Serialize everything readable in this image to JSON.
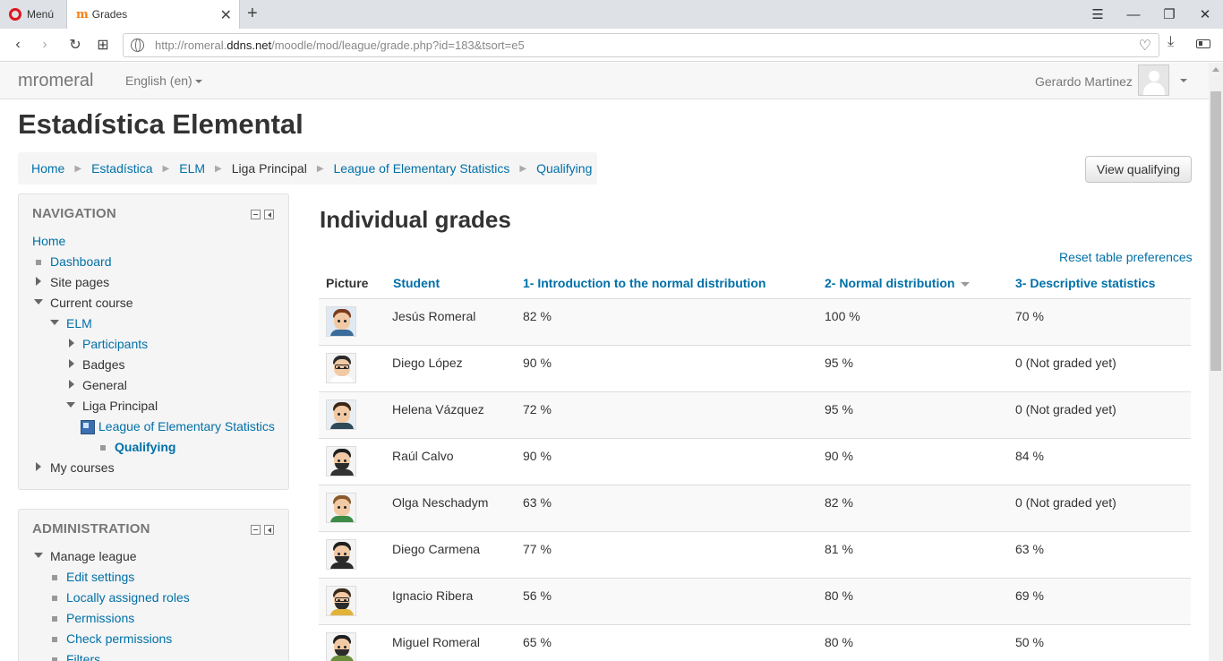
{
  "browser": {
    "menu_label": "Menú",
    "tab_title": "Grades",
    "url_prefix": "http://romeral.",
    "url_domain": "ddns.net",
    "url_path": "/moodle/mod/league/grade.php?id=183&tsort=e5"
  },
  "navbar": {
    "brand": "mromeral",
    "language": "English (en)",
    "user": "Gerardo Martinez"
  },
  "page": {
    "course_title": "Estadística Elemental",
    "breadcrumb": [
      "Home",
      "Estadística",
      "ELM",
      "Liga Principal",
      "League of Elementary Statistics",
      "Qualifying"
    ],
    "view_button": "View qualifying"
  },
  "navigation": {
    "title": "NAVIGATION",
    "home": "Home",
    "dashboard": "Dashboard",
    "site_pages": "Site pages",
    "current_course": "Current course",
    "course_short": "ELM",
    "participants": "Participants",
    "badges": "Badges",
    "general": "General",
    "liga": "Liga Principal",
    "league": "League of Elementary Statistics",
    "qualifying": "Qualifying",
    "my_courses": "My courses"
  },
  "administration": {
    "title": "ADMINISTRATION",
    "manage": "Manage league",
    "items": [
      "Edit settings",
      "Locally assigned roles",
      "Permissions",
      "Check permissions",
      "Filters"
    ]
  },
  "grades": {
    "heading": "Individual grades",
    "reset": "Reset table preferences",
    "columns": [
      "Picture",
      "Student",
      "1- Introduction to the normal distribution",
      "2- Normal distribution",
      "3- Descriptive statistics"
    ],
    "rows": [
      {
        "student": "Jesús Romeral",
        "g1": "82 %",
        "g2": "100 %",
        "g3": "70 %"
      },
      {
        "student": "Diego López",
        "g1": "90 %",
        "g2": "95 %",
        "g3": "0 (Not graded yet)"
      },
      {
        "student": "Helena Vázquez",
        "g1": "72 %",
        "g2": "95 %",
        "g3": "0 (Not graded yet)"
      },
      {
        "student": "Raúl Calvo",
        "g1": "90 %",
        "g2": "90 %",
        "g3": "84 %"
      },
      {
        "student": "Olga Neschadym",
        "g1": "63 %",
        "g2": "82 %",
        "g3": "0 (Not graded yet)"
      },
      {
        "student": "Diego Carmena",
        "g1": "77 %",
        "g2": "81 %",
        "g3": "63 %"
      },
      {
        "student": "Ignacio Ribera",
        "g1": "56 %",
        "g2": "80 %",
        "g3": "69 %"
      },
      {
        "student": "Miguel Romeral",
        "g1": "65 %",
        "g2": "80 %",
        "g3": "50 %"
      }
    ]
  },
  "colors": {
    "link": "#0070a8",
    "accent": "#f98012"
  }
}
